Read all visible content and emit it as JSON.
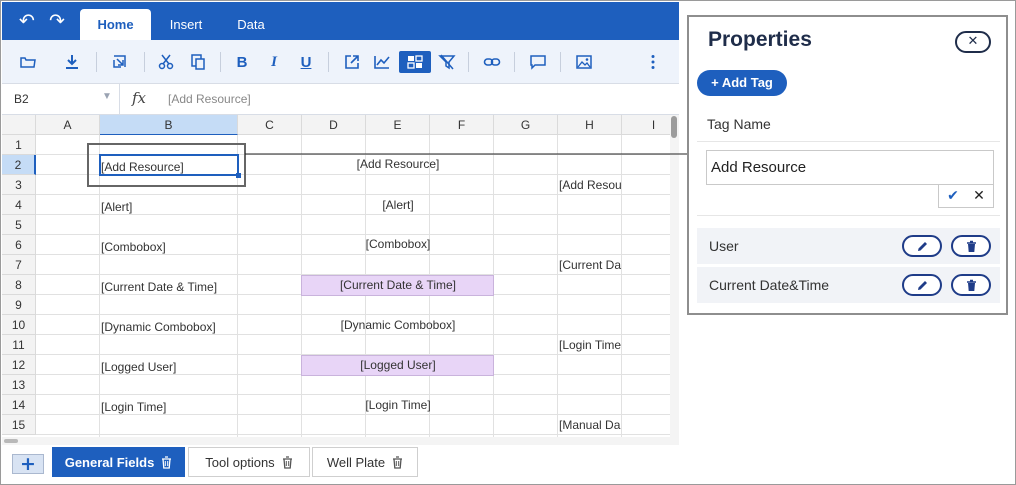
{
  "toolbar_tabs": {
    "undo": "↶",
    "redo": "↷",
    "tabs": [
      "Home",
      "Insert",
      "Data"
    ],
    "active_tab": "Home"
  },
  "toolbar": {
    "bold": "B",
    "italic": "I",
    "underline": "U",
    "icons": [
      "folder-icon",
      "download-icon",
      "resize-icon",
      "scissors-icon",
      "copy-icon",
      "bold-icon",
      "italic-icon",
      "underline-icon",
      "export-icon",
      "chart-icon",
      "cell-tag-icon",
      "clear-filter-icon",
      "link-icon",
      "comment-icon",
      "image-icon",
      "more-icon"
    ]
  },
  "formula_bar": {
    "cell_ref": "B2",
    "fx": "fx",
    "formula": "[Add Resource]"
  },
  "grid": {
    "columns": [
      "A",
      "B",
      "C",
      "D",
      "E",
      "F",
      "G",
      "H",
      "I"
    ],
    "rows": [
      "1",
      "2",
      "3",
      "4",
      "5",
      "6",
      "7",
      "8",
      "9",
      "10",
      "11",
      "12",
      "13",
      "14",
      "15"
    ],
    "selected_column": "B",
    "selected_row": "2",
    "cells": {
      "b2": "[Add Resource]",
      "b4": "[Alert]",
      "b6": "[Combobox]",
      "b8": "[Current Date & Time]",
      "b10": "[Dynamic Combobox]",
      "b12": "[Logged User]",
      "b14": "[Login Time]",
      "de2": "[Add Resource]",
      "de4": "[Alert]",
      "de6": "[Combobox]",
      "de8": "[Current Date & Time]",
      "de10": "[Dynamic Combobox]",
      "de12": "[Logged User]",
      "de14": "[Login Time]",
      "h3": "[Add Resou",
      "h7": "[Current Da",
      "h11": "[Login Time",
      "h15": "[Manual Da"
    }
  },
  "sheets": {
    "add": "+",
    "tabs": [
      "General Fields",
      "Tool options",
      "Well Plate"
    ],
    "active": "General Fields"
  },
  "properties": {
    "title": "Properties",
    "close": "✕",
    "add_tag": "+ Add Tag",
    "tag_name_label": "Tag Name",
    "tag_name_value": "Add Resource",
    "confirm": "✔",
    "cancel": "✕",
    "tags": [
      "User",
      "Current Date&Time"
    ]
  },
  "colors": {
    "accent": "#1e5fbe",
    "selection": "#c5dcf6",
    "purple_fill": "#e8d5f7"
  }
}
